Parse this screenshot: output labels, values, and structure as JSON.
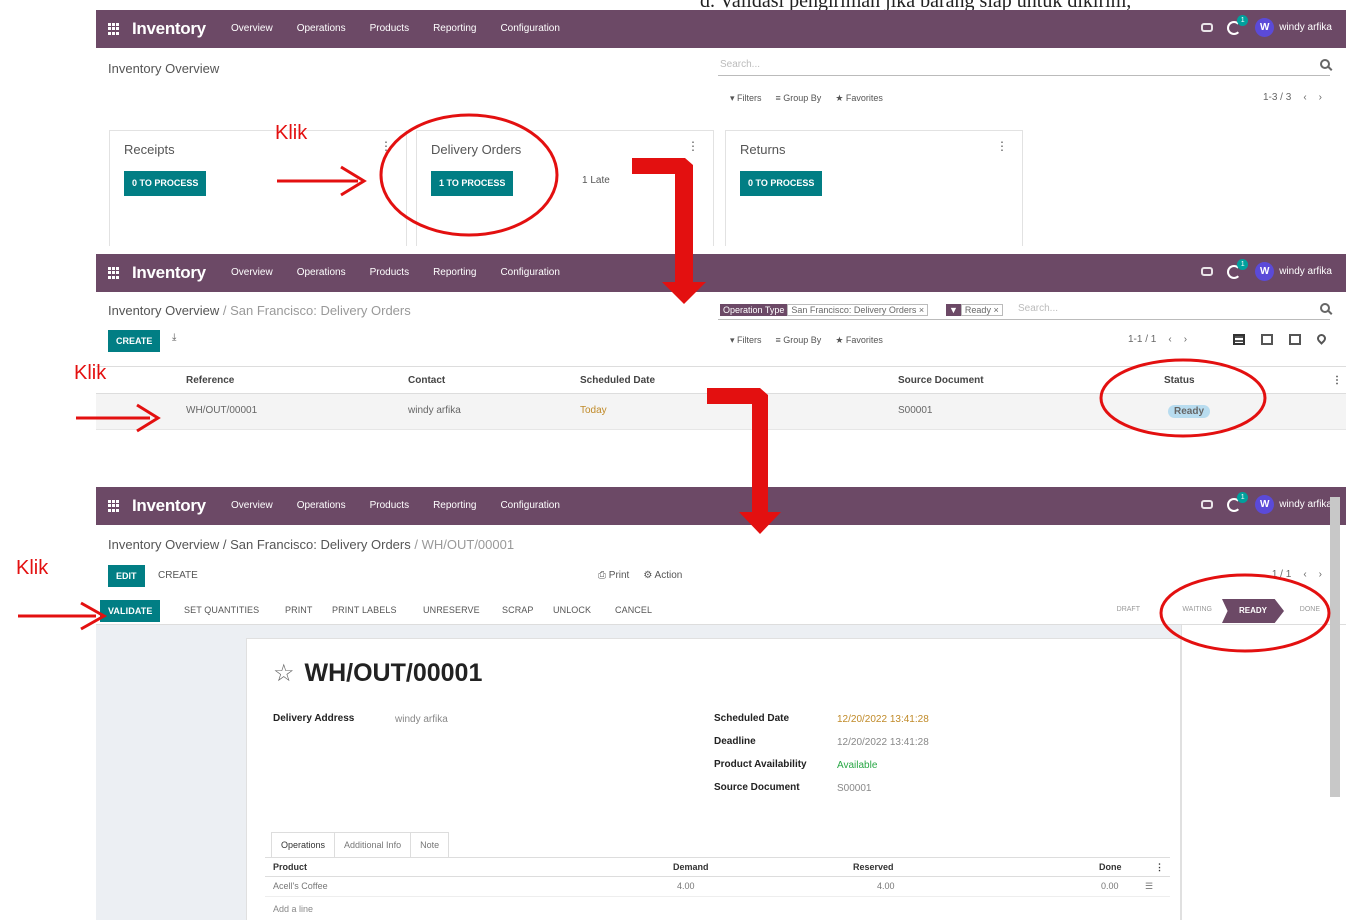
{
  "doc_caption": "d. Validasi pengiriman jika barang siap untuk dikirim,",
  "navbar": {
    "app_name": "Inventory",
    "menu": [
      "Overview",
      "Operations",
      "Products",
      "Reporting",
      "Configuration"
    ],
    "activity_count": "1",
    "user_initial": "W",
    "user_name": "windy arfika",
    "color": "#6c4966"
  },
  "panel1": {
    "title": "Inventory Overview",
    "search_placeholder": "Search...",
    "filters": "▾ Filters",
    "group_by": "≡ Group By",
    "favorites": "★ Favorites",
    "pager": "1-3 / 3",
    "cards": [
      {
        "title": "Receipts",
        "button": "0 TO PROCESS",
        "late": ""
      },
      {
        "title": "Delivery Orders",
        "button": "1 TO PROCESS",
        "late": "1 Late"
      },
      {
        "title": "Returns",
        "button": "0 TO PROCESS",
        "late": ""
      }
    ]
  },
  "panel2": {
    "breadcrumb_parent": "Inventory Overview",
    "breadcrumb_current": "San Francisco: Delivery Orders",
    "facet1_label": "Operation Type",
    "facet1_value": "San Francisco: Delivery Orders ×",
    "facet2_value": "Ready ×",
    "search_placeholder": "Search...",
    "create_label": "CREATE",
    "filters": "▾ Filters",
    "group_by": "≡ Group By",
    "favorites": "★ Favorites",
    "pager": "1-1 / 1",
    "columns": [
      "Reference",
      "Contact",
      "Scheduled Date",
      "Source Document",
      "Status"
    ],
    "row": {
      "reference": "WH/OUT/00001",
      "contact": "windy arfika",
      "scheduled": "Today",
      "source": "S00001",
      "status": "Ready"
    }
  },
  "panel3": {
    "breadcrumb_a": "Inventory Overview",
    "breadcrumb_b": "San Francisco: Delivery Orders",
    "breadcrumb_c": "WH/OUT/00001",
    "edit_label": "EDIT",
    "create_label": "CREATE",
    "print_label": "⎙ Print",
    "action_label": "⚙ Action",
    "pager": "1 / 1",
    "buttons": [
      "VALIDATE",
      "SET QUANTITIES",
      "PRINT",
      "PRINT LABELS",
      "UNRESERVE",
      "SCRAP",
      "UNLOCK",
      "CANCEL"
    ],
    "stages": [
      "DRAFT",
      "WAITING",
      "READY",
      "DONE"
    ],
    "record_name": "WH/OUT/00001",
    "delivery_address_label": "Delivery Address",
    "delivery_address": "windy arfika",
    "scheduled_label": "Scheduled Date",
    "scheduled": "12/20/2022 13:41:28",
    "deadline_label": "Deadline",
    "deadline": "12/20/2022 13:41:28",
    "availability_label": "Product Availability",
    "availability": "Available",
    "source_label": "Source Document",
    "source": "S00001",
    "tabs": [
      "Operations",
      "Additional Info",
      "Note"
    ],
    "op_columns": [
      "Product",
      "Demand",
      "Reserved",
      "Done"
    ],
    "op_row": {
      "product": "Acell's Coffee",
      "demand": "4.00",
      "reserved": "4.00",
      "done": "0.00"
    },
    "add_line": "Add a line"
  },
  "annotations": {
    "klik": "Klik",
    "color": "#e31010"
  }
}
